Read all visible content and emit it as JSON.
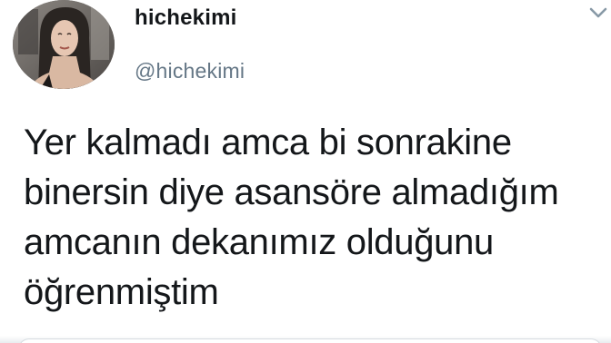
{
  "tweet": {
    "display_name": "hichekimi",
    "handle": "@hichekimi",
    "text_lines": [
      "Yer kalmadı amca bi sonrakine",
      "binersin diye asansöre almadığım",
      "amcanın dekanımız olduğunu",
      "öğrenmiştim"
    ]
  },
  "icons": {
    "avatar": "avatar-photo",
    "more": "chevron-down-icon"
  },
  "colors": {
    "text": "#14171a",
    "handle": "#657786",
    "background": "#ffffff"
  }
}
